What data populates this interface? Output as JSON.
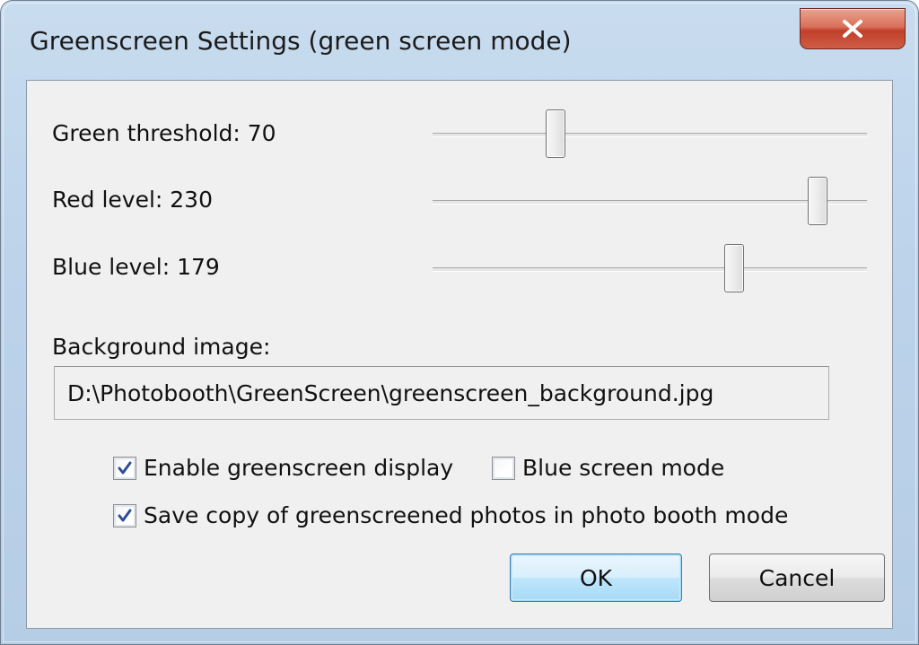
{
  "window": {
    "title": "Greenscreen Settings (green screen mode)",
    "close_icon": "close-x-icon"
  },
  "sliders": [
    {
      "label": "Green threshold: 70",
      "value": 70,
      "min": 0,
      "max": 255
    },
    {
      "label": "Red level: 230",
      "value": 230,
      "min": 0,
      "max": 255
    },
    {
      "label": "Blue level: 179",
      "value": 179,
      "min": 0,
      "max": 255
    }
  ],
  "background": {
    "label": "Background image:",
    "path": "D:\\Photobooth\\GreenScreen\\greenscreen_background.jpg"
  },
  "options": {
    "enable_display": {
      "label": "Enable greenscreen display",
      "checked": true
    },
    "blue_screen": {
      "label": "Blue screen mode",
      "checked": false
    },
    "save_copy": {
      "label": "Save copy of greenscreened photos in photo booth mode",
      "checked": true
    }
  },
  "buttons": {
    "ok": "OK",
    "cancel": "Cancel"
  },
  "colors": {
    "accent": "#3c7fb1",
    "close": "#c0402a",
    "check": "#2b4f9c"
  }
}
